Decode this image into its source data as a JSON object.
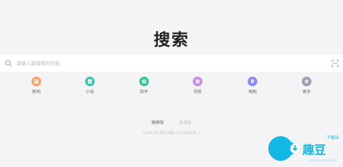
{
  "header": {
    "title": "搜索"
  },
  "search": {
    "placeholder": "请输入要搜索的内容",
    "value": ""
  },
  "quick_links": [
    {
      "label": "新闻",
      "icon": "news-icon",
      "color": "#f7a36b"
    },
    {
      "label": "小说",
      "icon": "book-icon",
      "color": "#39c7b5"
    },
    {
      "label": "知乎",
      "icon": "zhihu-icon",
      "color": "#3cc69c"
    },
    {
      "label": "导航",
      "icon": "compass-icon",
      "color": "#c78be8"
    },
    {
      "label": "地图",
      "icon": "map-pin-icon",
      "color": "#8d8cf5"
    },
    {
      "label": "更多",
      "icon": "more-icon",
      "color": "#9aa3ad"
    }
  ],
  "footer": {
    "links": [
      "触屏版",
      "极速版"
    ],
    "icp": "©SM.CN 粤ICP备13072080号-2"
  },
  "watermark": {
    "logo_text": "趣豆",
    "small_text": "下载站",
    "url": "www.qudou.com",
    "color": "#13b9e6"
  }
}
